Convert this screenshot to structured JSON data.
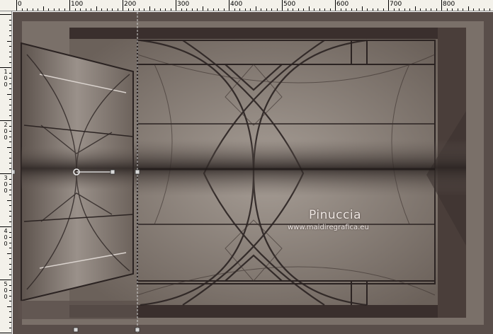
{
  "ruler": {
    "top_labels": [
      "0",
      "100",
      "200",
      "300",
      "400",
      "500",
      "600",
      "700",
      "800"
    ],
    "left_labels": [
      {
        "h": "1",
        "a": "0",
        "b": "0"
      },
      {
        "h": "2",
        "a": "0",
        "b": "0"
      },
      {
        "h": "3",
        "a": "0",
        "b": "0"
      },
      {
        "h": "4",
        "a": "0",
        "b": "0"
      },
      {
        "h": "5",
        "a": "0",
        "b": "0"
      }
    ]
  },
  "watermark": {
    "name": "Pinuccia",
    "url": "www.maidiregrafica.eu"
  },
  "colors": {
    "frame_dark": "#3a2f2d",
    "background_brown": "#6e645c",
    "panel_taupe": "#8a8079",
    "line_dark": "#2b2322",
    "guide": "#c8c8c8"
  }
}
